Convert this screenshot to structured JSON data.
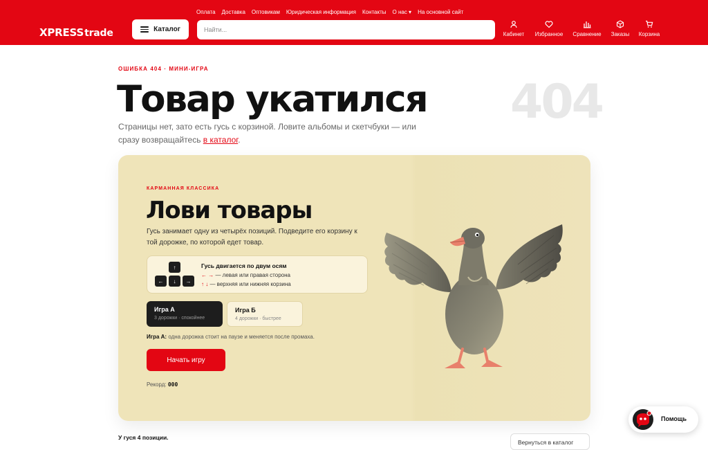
{
  "header": {
    "logo": {
      "part1": "XPRESS",
      "part2": "trade"
    },
    "top_links": [
      "Оплата",
      "Доставка",
      "Оптовикам",
      "Юридическая информация",
      "Контакты",
      "О нас ▾",
      "На основной сайт"
    ],
    "catalog_label": "Каталог",
    "search_placeholder": "Найти...",
    "icons": [
      {
        "label": "Кабинет",
        "icon": "user-icon"
      },
      {
        "label": "Избранное",
        "icon": "heart-icon"
      },
      {
        "label": "Сравнение",
        "icon": "compare-icon"
      },
      {
        "label": "Заказы",
        "icon": "box-icon"
      },
      {
        "label": "Корзина",
        "icon": "cart-icon"
      }
    ]
  },
  "hero": {
    "kicker": "ОШИБКА 404 · МИНИ-ИГРА",
    "title": "Товар укатился",
    "big_code": "404",
    "lead_text": "Страницы нет, зато есть гусь с корзиной. Ловите альбомы и скетчбуки — или сразу возвращайтесь ",
    "lead_link": "в каталог",
    "lead_end": "."
  },
  "game": {
    "kicker": "КАРМАННАЯ КЛАССИКА",
    "title": "Лови товары",
    "description": "Гусь занимает одну из четырёх позиций. Подведите его корзину к той дорожке, по которой едет товар.",
    "controls": {
      "title": "Гусь двигается по двум осям",
      "line1_arrows": "← →",
      "line1_text": " — левая или правая сторона",
      "line2_arrows": "↑ ↓",
      "line2_text": " — верхняя или нижняя корзина",
      "keys": {
        "up": "↑",
        "left": "←",
        "down": "↓",
        "right": "→"
      }
    },
    "modes": [
      {
        "title": "Игра А",
        "subtitle": "3 дорожки · спокойнее",
        "active": true
      },
      {
        "title": "Игра Б",
        "subtitle": "4 дорожки · быстрее",
        "active": false
      }
    ],
    "mode_note_label": "Игра А:",
    "mode_note_text": " одна дорожка стоит на паузе и меняется после промаха.",
    "start_label": "Начать игру",
    "record_label": "Рекорд: ",
    "record_value": "000"
  },
  "footer": {
    "positions_text": "У гуся 4 позиции.",
    "back_button": "Вернуться в каталог"
  },
  "help": {
    "label": "Помощь"
  },
  "colors": {
    "brand": "#e30613",
    "card": "#efe4b9",
    "dark": "#1d1d1d"
  }
}
